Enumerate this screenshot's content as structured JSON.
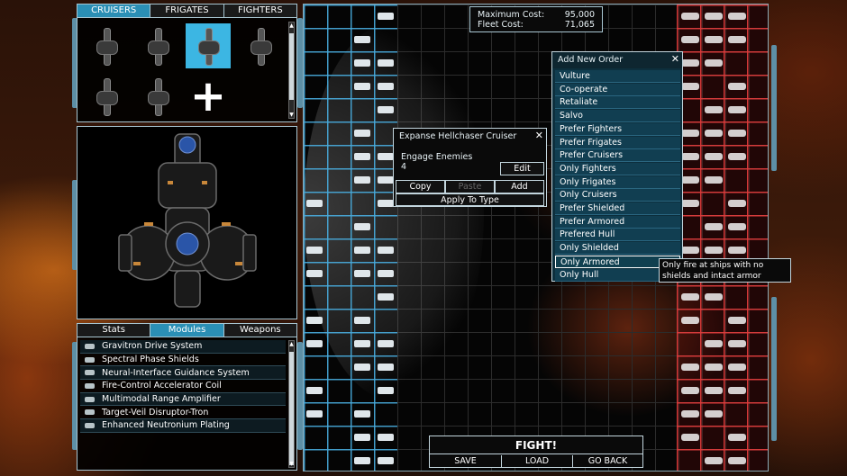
{
  "ship_tabs": [
    {
      "label": "CRUISERS",
      "active": true
    },
    {
      "label": "FRIGATES",
      "active": false
    },
    {
      "label": "FIGHTERS",
      "active": false
    }
  ],
  "info_tabs": [
    {
      "label": "Stats",
      "active": false
    },
    {
      "label": "Modules",
      "active": true
    },
    {
      "label": "Weapons",
      "active": false
    }
  ],
  "modules": [
    "Gravitron Drive System",
    "Spectral Phase Shields",
    "Neural-Interface Guidance System",
    "Fire-Control Accelerator Coil",
    "Multimodal Range Amplifier",
    "Target-Veil Disruptor-Tron",
    "Enhanced Neutronium Plating"
  ],
  "cost": {
    "max_label": "Maximum Cost:",
    "max_value": "95,000",
    "fleet_label": "Fleet Cost:",
    "fleet_value": "71,065"
  },
  "ship_dialog": {
    "title": "Expanse Hellchaser Cruiser",
    "order_name": "Engage Enemies",
    "order_value": "4",
    "edit_label": "Edit",
    "copy_label": "Copy",
    "paste_label": "Paste",
    "add_label": "Add",
    "apply_label": "Apply To Type"
  },
  "order_menu": {
    "title": "Add New Order",
    "items": [
      "Vulture",
      "Co-operate",
      "Retaliate",
      "Salvo",
      "Prefer Fighters",
      "Prefer Frigates",
      "Prefer Cruisers",
      "Only Fighters",
      "Only Frigates",
      "Only Cruisers",
      "Prefer Shielded",
      "Prefer Armored",
      "Prefered Hull",
      "Only Shielded",
      "Only Armored",
      "Only Hull"
    ],
    "hover_index": 14
  },
  "tooltip": "Only fire at ships with no shields and intact armor",
  "actions": {
    "fight": "FIGHT!",
    "save": "SAVE",
    "load": "LOAD",
    "go_back": "GO BACK"
  },
  "colors": {
    "accent": "#2b8fb5",
    "player_grid": "#46aadc",
    "enemy_grid": "#dc3c3c"
  }
}
